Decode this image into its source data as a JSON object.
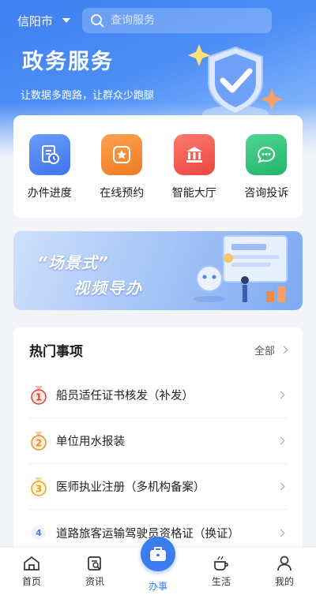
{
  "header": {
    "city": "信阳市",
    "search_placeholder": "查询服务",
    "title": "政务服务",
    "subtitle": "让数据多跑路，让群众少跑腿"
  },
  "services": [
    {
      "label": "办件进度",
      "icon": "progress-doc-icon",
      "color": "#4a82f3"
    },
    {
      "label": "在线预约",
      "icon": "star-badge-icon",
      "color": "#f5882f"
    },
    {
      "label": "智能大厅",
      "icon": "hall-building-icon",
      "color": "#f0534d"
    },
    {
      "label": "咨询投诉",
      "icon": "chat-bubble-icon",
      "color": "#2fc27a"
    }
  ],
  "banner": {
    "line1": "“场景式”",
    "line2": "视频导办"
  },
  "hot": {
    "title": "热门事项",
    "more": "全部",
    "items": [
      {
        "rank": "1",
        "label": "船员适任证书核发（补发）"
      },
      {
        "rank": "2",
        "label": "单位用水报装"
      },
      {
        "rank": "3",
        "label": "医师执业注册（多机构备案）"
      },
      {
        "rank": "4",
        "label": "道路旅客运输驾驶员资格证（换证）"
      }
    ]
  },
  "tabs": [
    {
      "label": "首页",
      "icon": "home-icon"
    },
    {
      "label": "资讯",
      "icon": "news-icon"
    },
    {
      "label": "办事",
      "icon": "briefcase-icon",
      "active": true
    },
    {
      "label": "生活",
      "icon": "coffee-cup-icon"
    },
    {
      "label": "我的",
      "icon": "person-icon"
    }
  ],
  "colors": {
    "primary": "#3b7cf0",
    "gold_medal": "#e0413a",
    "silver_medal": "#f08a24",
    "bronze_medal": "#e8a21c"
  }
}
